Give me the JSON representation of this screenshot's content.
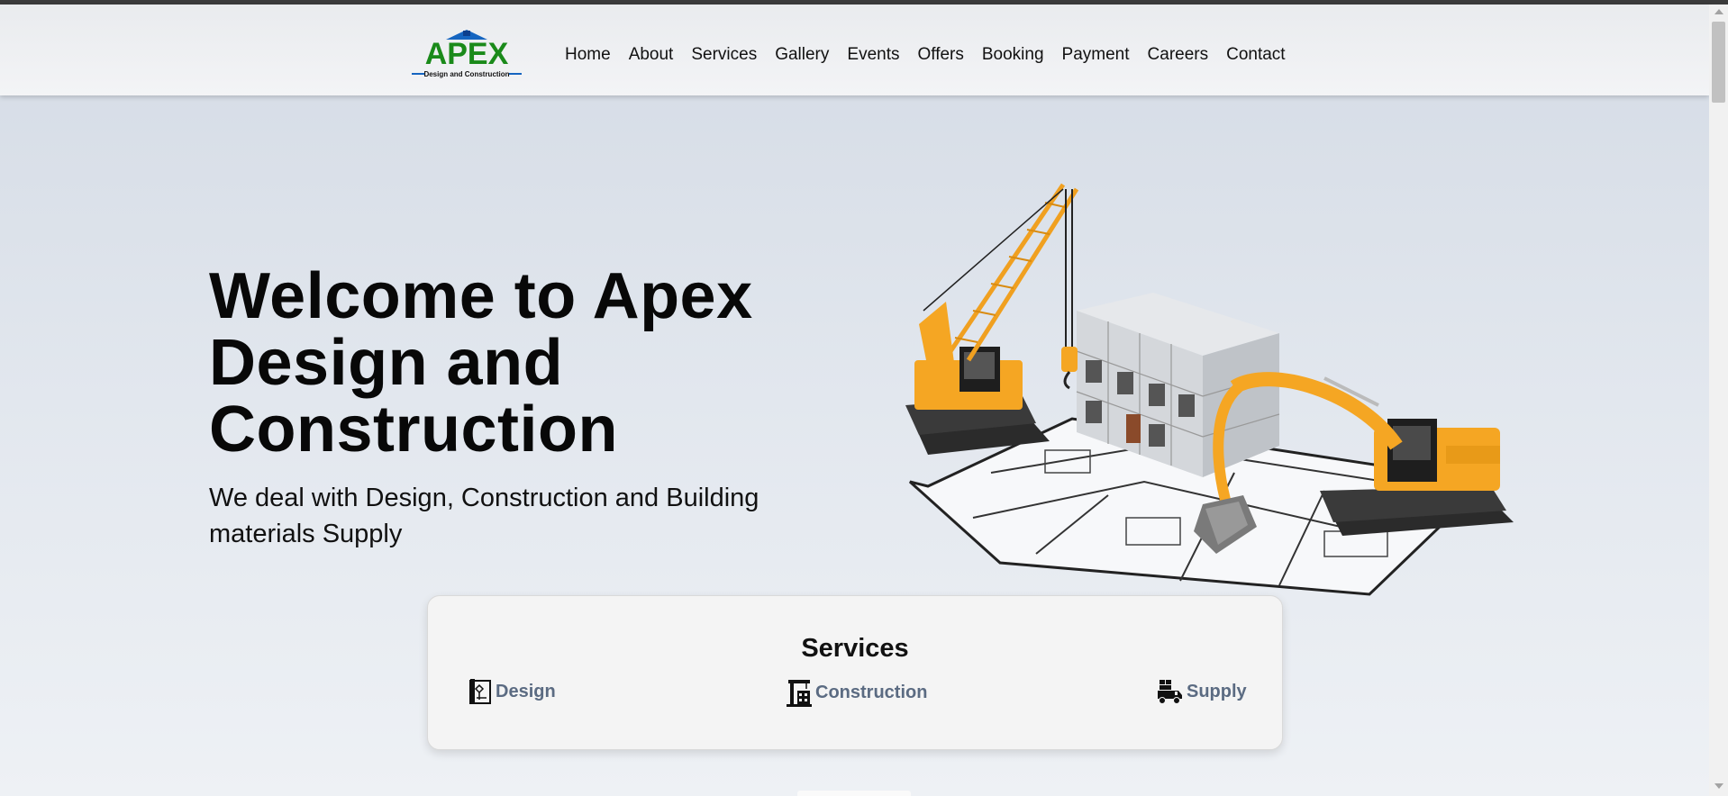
{
  "brand": {
    "logo_text": "APEX",
    "logo_tagline": "Design and Construction",
    "colors": {
      "logo_green": "#1a8a1a",
      "logo_blue": "#1565c0"
    }
  },
  "nav": {
    "items": [
      "Home",
      "About",
      "Services",
      "Gallery",
      "Events",
      "Offers",
      "Booking",
      "Payment",
      "Careers",
      "Contact"
    ]
  },
  "hero": {
    "title_line1": "Welcome to Apex",
    "title_line2": "Design and",
    "title_line3": "Construction",
    "subtitle": "We deal with Design, Construction and Building materials Supply",
    "image": "construction-cranes-excavator-building-blueprint"
  },
  "services": {
    "title": "Services",
    "items": [
      {
        "label": "Design",
        "icon": "blueprint-icon"
      },
      {
        "label": "Construction",
        "icon": "crane-building-icon"
      },
      {
        "label": "Supply",
        "icon": "delivery-truck-icon"
      }
    ],
    "colors": {
      "label": "#5b6b82"
    }
  }
}
